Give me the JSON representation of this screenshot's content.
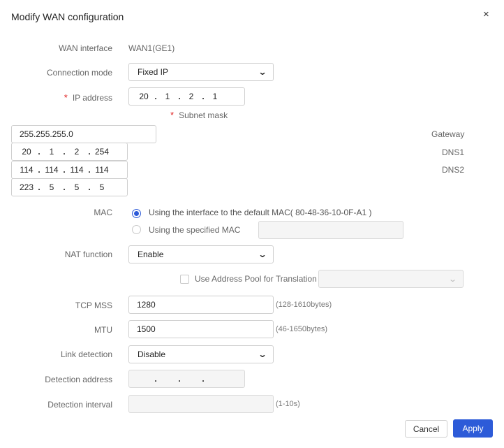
{
  "dialog": {
    "title": "Modify WAN configuration",
    "close_glyph": "×"
  },
  "labels": {
    "wan_interface": "WAN interface",
    "connection_mode": "Connection mode",
    "ip_address": "IP address",
    "subnet_mask": "Subnet mask",
    "gateway": "Gateway",
    "dns1": "DNS1",
    "dns2": "DNS2",
    "mac": "MAC",
    "nat_function": "NAT function",
    "tcp_mss": "TCP MSS",
    "mtu": "MTU",
    "link_detection": "Link detection",
    "detection_address": "Detection address",
    "detection_interval": "Detection interval",
    "required_mark": "*"
  },
  "values": {
    "wan_interface": "WAN1(GE1)",
    "connection_mode": "Fixed IP",
    "ip_address": [
      "20",
      "1",
      "2",
      "1"
    ],
    "subnet_mask": "255.255.255.0",
    "gateway": [
      "20",
      "1",
      "2",
      "254"
    ],
    "dns1": [
      "114",
      "114",
      "114",
      "114"
    ],
    "dns2": [
      "223",
      "5",
      "5",
      "5"
    ],
    "nat_function": "Enable",
    "tcp_mss": "1280",
    "mtu": "1500",
    "link_detection": "Disable",
    "detection_address": [
      "",
      "",
      "",
      ""
    ],
    "detection_interval": ""
  },
  "mac": {
    "option_default": "Using the interface to the default MAC( 80-48-36-10-0F-A1 )",
    "option_specified": "Using the specified MAC",
    "selected": "default",
    "specified_value": ""
  },
  "address_pool": {
    "label": "Use Address Pool for Translation",
    "checked": false,
    "selected": ""
  },
  "hints": {
    "tcp_mss": "(128-1610bytes)",
    "mtu": "(46-1650bytes)",
    "detection_interval": "(1-10s)"
  },
  "buttons": {
    "cancel": "Cancel",
    "apply": "Apply"
  },
  "colors": {
    "accent": "#2d5bd8",
    "required": "#e02020"
  },
  "icons": {
    "close": "close-icon",
    "select_chevron": "chevron-down-icon"
  }
}
